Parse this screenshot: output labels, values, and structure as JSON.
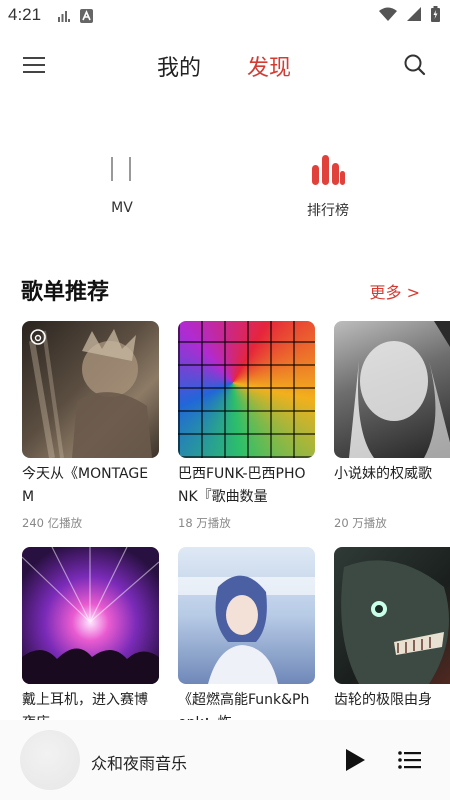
{
  "status": {
    "time": "4:21"
  },
  "nav": {
    "tab_mine": "我的",
    "tab_discover": "发现",
    "menu_icon": "menu-icon",
    "search_icon": "search-icon"
  },
  "quick": [
    {
      "label": "MV",
      "icon": "mv-icon"
    },
    {
      "label": "排行榜",
      "icon": "chart-icon",
      "color": "#e0413a"
    }
  ],
  "section": {
    "title": "歌单推荐",
    "more": "更多 >"
  },
  "playlists": [
    {
      "title": "今天从《MONTAGEM",
      "plays": "240 亿播放"
    },
    {
      "title": "巴西FUNK-巴西PHONK『歌曲数量",
      "plays": "18 万播放"
    },
    {
      "title": "小说妹的权威歌",
      "plays": "20 万播放"
    },
    {
      "title": "戴上耳机，进入赛博夜店",
      "plays": ""
    },
    {
      "title": "《超燃高能Funk&Phonk：炸",
      "plays": ""
    },
    {
      "title": "齿轮的极限由身",
      "plays": ""
    }
  ],
  "player": {
    "title": "众和夜雨音乐"
  },
  "colors": {
    "accent": "#d43c33"
  }
}
